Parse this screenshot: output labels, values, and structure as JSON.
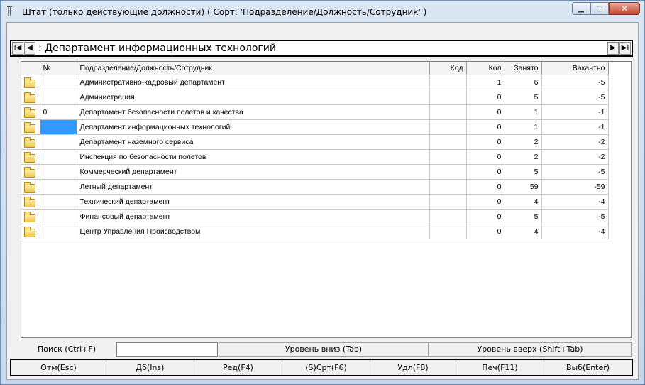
{
  "window": {
    "title": "Штат (только действующие должности) ( Сорт: 'Подразделение/Должность/Сотрудник' )",
    "icon": "staff-icon",
    "controls": [
      "minimize-icon",
      "maximize-icon",
      "close-icon"
    ]
  },
  "nav": {
    "first_label": "I◀",
    "prev_label": "◀",
    "next_label": "▶",
    "last_label": "▶I",
    "current": ": Департамент информационных технологий"
  },
  "grid": {
    "columns": [
      "№",
      "Подразделение/Должность/Сотрудник",
      "Код",
      "Кол",
      "Занято",
      "Вакантно"
    ],
    "rows": [
      {
        "num": "",
        "name": "Административно-кадровый департамент",
        "code": "",
        "qty": "1",
        "taken": "6",
        "vacant": "-5"
      },
      {
        "num": "",
        "name": "Администрация",
        "code": "",
        "qty": "0",
        "taken": "5",
        "vacant": "-5"
      },
      {
        "num": "0",
        "name": "Департамент безопасности полетов и качества",
        "code": "",
        "qty": "0",
        "taken": "1",
        "vacant": "-1"
      },
      {
        "num": "",
        "name": "Департамент информационных технологий",
        "code": "",
        "qty": "0",
        "taken": "1",
        "vacant": "-1"
      },
      {
        "num": "",
        "name": "Департамент наземного сервиса",
        "code": "",
        "qty": "0",
        "taken": "2",
        "vacant": "-2"
      },
      {
        "num": "",
        "name": "Инспекция по безопасности полетов",
        "code": "",
        "qty": "0",
        "taken": "2",
        "vacant": "-2"
      },
      {
        "num": "",
        "name": "Коммерческий департамент",
        "code": "",
        "qty": "0",
        "taken": "5",
        "vacant": "-5"
      },
      {
        "num": "",
        "name": "Летный департамент",
        "code": "",
        "qty": "0",
        "taken": "59",
        "vacant": "-59"
      },
      {
        "num": "",
        "name": "Технический департамент",
        "code": "",
        "qty": "0",
        "taken": "4",
        "vacant": "-4"
      },
      {
        "num": "",
        "name": "Финансовый департамент",
        "code": "",
        "qty": "0",
        "taken": "5",
        "vacant": "-5"
      },
      {
        "num": "",
        "name": "Центр Управления Производством",
        "code": "",
        "qty": "0",
        "taken": "4",
        "vacant": "-4"
      }
    ],
    "selected_row": 3
  },
  "search": {
    "label": "Поиск (Ctrl+F)",
    "value": "",
    "level_down": "Уровень вниз (Tab)",
    "level_up": "Уровень вверх (Shift+Tab)"
  },
  "toolbar": {
    "buttons": [
      "Отм(Esc)",
      "Дб(Ins)",
      "Ред(F4)",
      "(S)Срт(F6)",
      "Удл(F8)",
      "Печ(F11)",
      "Выб(Enter)"
    ]
  }
}
